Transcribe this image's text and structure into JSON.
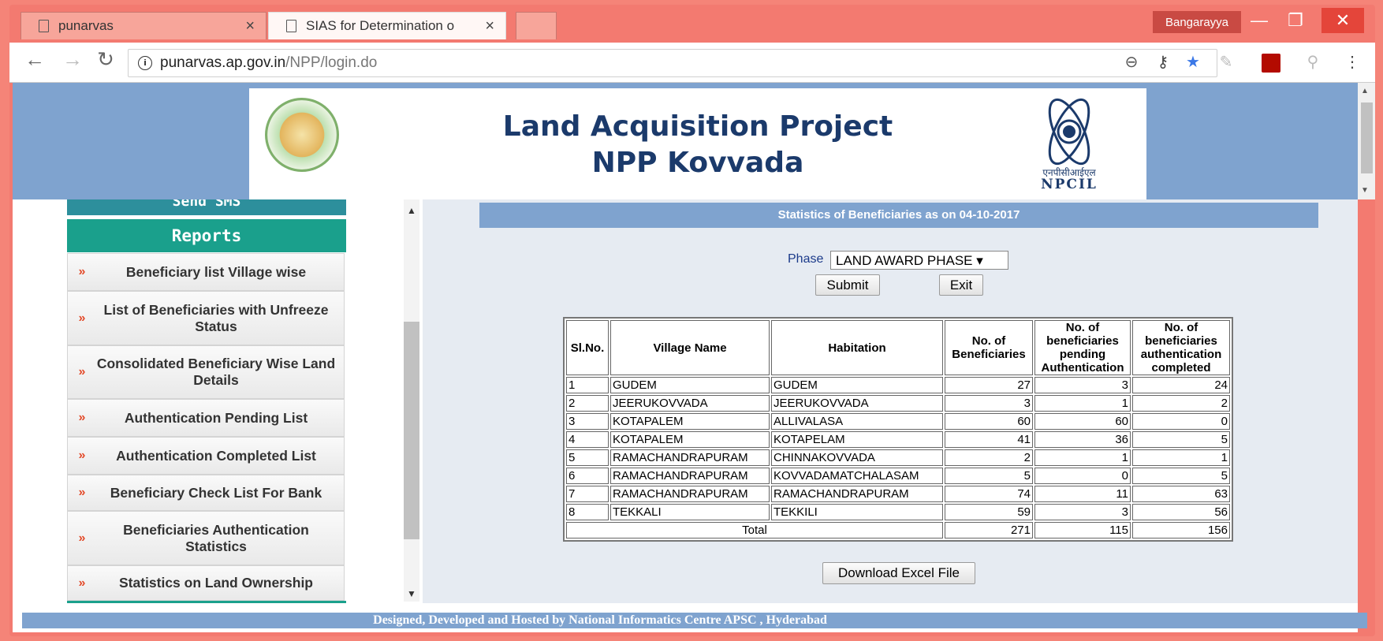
{
  "browser": {
    "tabs": [
      {
        "title": "punarvas"
      },
      {
        "title": "SIAS for Determination o"
      }
    ],
    "user_label": "Bangarayya",
    "url_host": "punarvas.ap.gov.in",
    "url_path": "/NPP/login.do"
  },
  "header": {
    "title_line1": "Land Acquisition Project",
    "title_line2": "NPP Kovvada",
    "npcil_hindi": "एनपीसीआईएल",
    "npcil": "NPCIL"
  },
  "sidebar": {
    "send_sms": "Send SMS",
    "section_title": "Reports",
    "items": [
      {
        "label": "Beneficiary list Village wise"
      },
      {
        "label": "List of Beneficiaries with Unfreeze Status"
      },
      {
        "label": "Consolidated Beneficiary Wise Land Details"
      },
      {
        "label": "Authentication Pending List"
      },
      {
        "label": "Authentication Completed List"
      },
      {
        "label": "Beneficiary Check List For Bank"
      },
      {
        "label": "Beneficiaries Authentication Statistics"
      },
      {
        "label": "Statistics on Land Ownership"
      }
    ],
    "arrow": "»"
  },
  "main": {
    "heading": "Statistics of Beneficiaries as on 04-10-2017",
    "phase_label": "Phase",
    "phase_value": "LAND AWARD PHASE ▾",
    "submit": "Submit",
    "exit": "Exit",
    "table": {
      "headers": [
        "Sl.No.",
        "Village Name",
        "Habitation",
        "No. of Beneficiaries",
        "No. of beneficiaries pending Authentication",
        "No. of beneficiaries authentication completed"
      ],
      "rows": [
        [
          "1",
          "GUDEM",
          "GUDEM",
          "27",
          "3",
          "24"
        ],
        [
          "2",
          "JEERUKOVVADA",
          "JEERUKOVVADA",
          "3",
          "1",
          "2"
        ],
        [
          "3",
          "KOTAPALEM",
          "ALLIVALASA",
          "60",
          "60",
          "0"
        ],
        [
          "4",
          "KOTAPALEM",
          "KOTAPELAM",
          "41",
          "36",
          "5"
        ],
        [
          "5",
          "RAMACHANDRAPURAM",
          "CHINNAKOVVADA",
          "2",
          "1",
          "1"
        ],
        [
          "6",
          "RAMACHANDRAPURAM",
          "KOVVADAMATCHALASAM",
          "5",
          "0",
          "5"
        ],
        [
          "7",
          "RAMACHANDRAPURAM",
          "RAMACHANDRAPURAM",
          "74",
          "11",
          "63"
        ],
        [
          "8",
          "TEKKALI",
          "TEKKILI",
          "59",
          "3",
          "56"
        ]
      ],
      "total_label": "Total",
      "totals": [
        "271",
        "115",
        "156"
      ]
    },
    "download": "Download Excel File"
  },
  "footer": {
    "text": "Designed, Developed and Hosted by National Informatics Centre APSC , Hyderabad"
  }
}
